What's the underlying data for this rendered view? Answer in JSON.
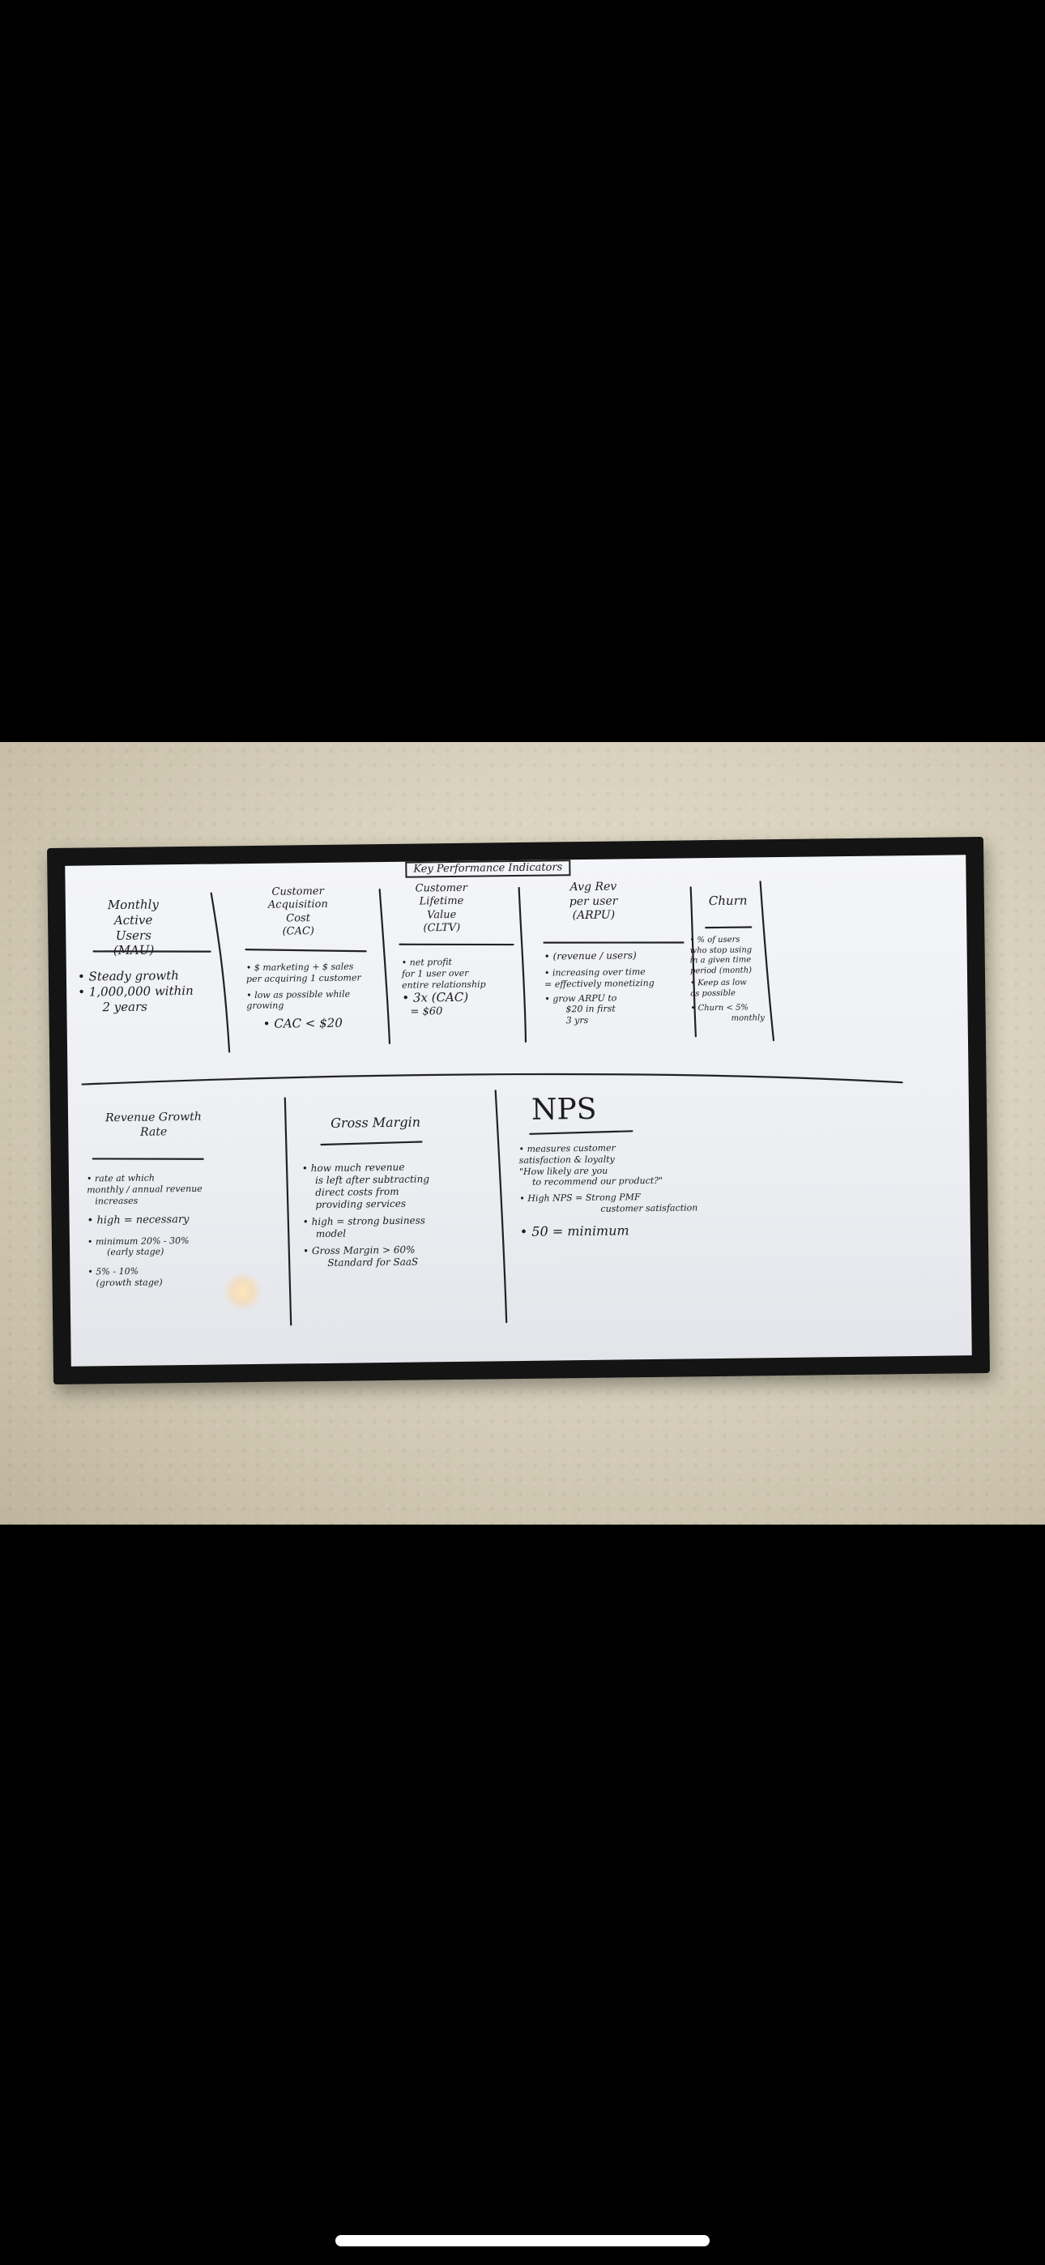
{
  "board": {
    "title": "Key Performance Indicators",
    "mau": {
      "heading": [
        "Monthly",
        "Active",
        "Users",
        "(MAU)"
      ],
      "bullets": [
        "• Steady growth",
        "• 1,000,000 within",
        "2 years"
      ]
    },
    "cac": {
      "heading": [
        "Customer",
        "Acquisition",
        "Cost",
        "(CAC)"
      ],
      "bullets": [
        "• $ marketing + $ sales",
        "per acquiring 1 customer",
        "• low as possible while",
        "growing",
        "• CAC < $20"
      ]
    },
    "cltv": {
      "heading": [
        "Customer",
        "Lifetime",
        "Value",
        "(CLTV)"
      ],
      "bullets": [
        "• net profit",
        "for 1 user over",
        "entire relationship",
        "• 3x (CAC)",
        "= $60"
      ]
    },
    "arpu": {
      "heading": [
        "Avg Rev",
        "per user",
        "(ARPU)"
      ],
      "bullets": [
        "• (revenue / users)",
        "• increasing over time",
        "= effectively monetizing",
        "• grow ARPU to",
        "$20 in first",
        "3 yrs"
      ]
    },
    "churn": {
      "heading": [
        "Churn"
      ],
      "bullets": [
        "• % of users",
        "who stop using",
        "in a given time",
        "period (month)",
        "• Keep as low",
        "as possible",
        "• Churn < 5%",
        "monthly"
      ]
    },
    "revenue_growth": {
      "heading": [
        "Revenue Growth",
        "Rate"
      ],
      "bullets": [
        "• rate at which",
        "monthly / annual revenue",
        "increases",
        "• high = necessary",
        "• minimum 20% - 30%",
        "(early stage)",
        "• 5% - 10%",
        "(growth stage)"
      ]
    },
    "gross_margin": {
      "heading": [
        "Gross Margin"
      ],
      "bullets": [
        "• how much revenue",
        "is left after subtracting",
        "direct costs from",
        "providing services",
        "• high = strong business",
        "model",
        "• Gross Margin > 60%",
        "Standard for SaaS"
      ]
    },
    "nps": {
      "heading": [
        "NPS"
      ],
      "bullets": [
        "• measures customer",
        "satisfaction & loyalty",
        "\"How likely are you",
        "to recommend our product?\"",
        "• High NPS = Strong PMF",
        "customer satisfaction",
        "• 50 = minimum"
      ]
    }
  }
}
